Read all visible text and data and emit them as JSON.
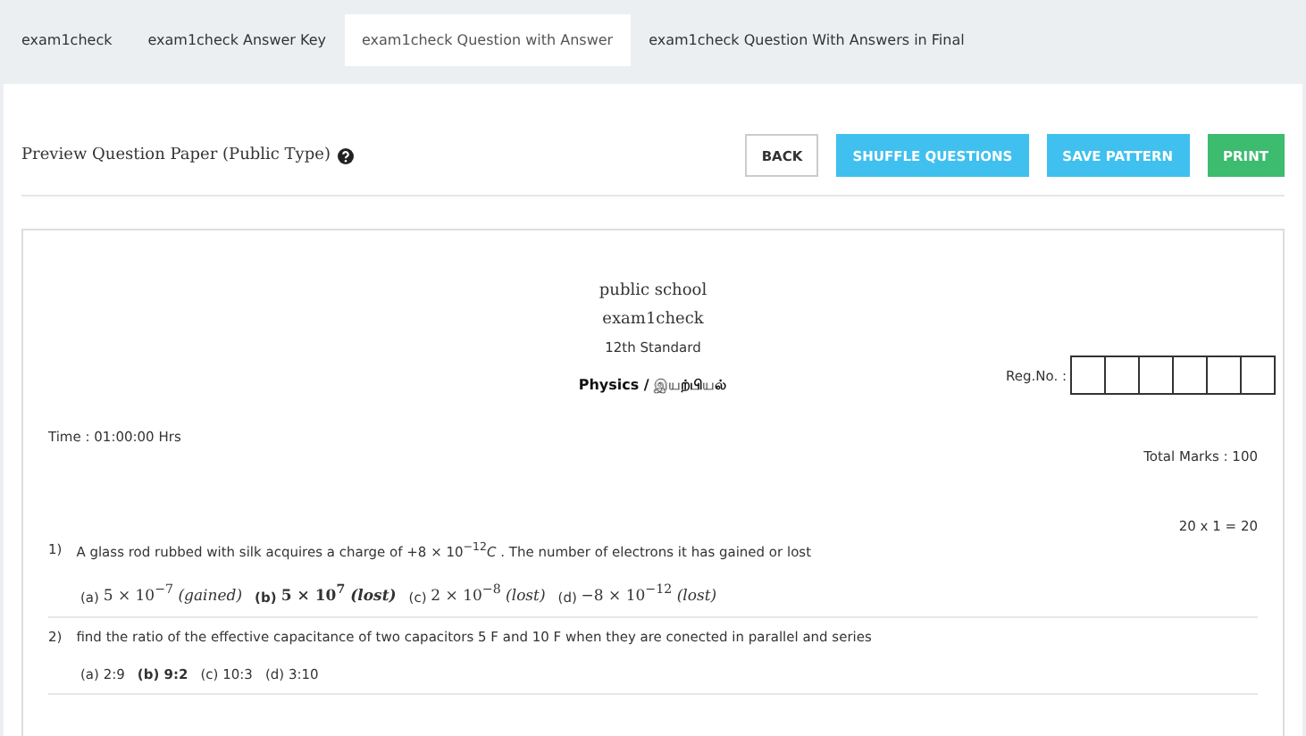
{
  "tabs": [
    {
      "label": "exam1check",
      "selected": false
    },
    {
      "label": "exam1check Answer Key",
      "selected": false
    },
    {
      "label": "exam1check Question with Answer",
      "selected": true
    },
    {
      "label": "exam1check Question With Answers in Final",
      "selected": false
    }
  ],
  "header": {
    "title": "Preview Question Paper (Public Type)",
    "buttons": [
      {
        "label": "BACK",
        "kind": "plain"
      },
      {
        "label": "SHUFFLE QUESTIONS",
        "kind": "info"
      },
      {
        "label": "SAVE PATTERN",
        "kind": "info"
      },
      {
        "label": "PRINT",
        "kind": "success"
      }
    ]
  },
  "paper": {
    "school": "public school",
    "exam": "exam1check",
    "standard": "12th Standard",
    "subject": "Physics / இயற்பியல்",
    "reg_label": "Reg.No. :",
    "time": "Time : 01:00:00 Hrs",
    "total_marks": "Total Marks : 100",
    "section_marks": "20 x 1 = 20",
    "questions": [
      {
        "number": "1)",
        "text": "A glass rod rubbed with silk acquires a charge of +8 × 10$^{−12}$*C* . The number of electrons it has gained or lost",
        "math_options": true,
        "options": [
          {
            "label": "(a)",
            "text": "5 × 10$^{−7}$ *(gained)*",
            "selected": false
          },
          {
            "label": "(b)",
            "text": "5 × 10$^{7}$ *(lost)*",
            "selected": true
          },
          {
            "label": "(c)",
            "text": "2 × 10$^{−8}$ *(lost)*",
            "selected": false
          },
          {
            "label": "(d)",
            "text": "−8 × 10$^{−12}$ *(lost)*",
            "selected": false
          }
        ]
      },
      {
        "number": "2)",
        "text": "find the ratio of the effective capacitance of two capacitors 5 F and 10 F when they are  conected in  parallel and series",
        "math_options": false,
        "options": [
          {
            "label": "(a)",
            "text": "2:9",
            "selected": false
          },
          {
            "label": "(b)",
            "text": "9:2",
            "selected": true
          },
          {
            "label": "(c)",
            "text": "10:3",
            "selected": false
          },
          {
            "label": "(d)",
            "text": "3:10",
            "selected": false
          }
        ]
      }
    ]
  }
}
